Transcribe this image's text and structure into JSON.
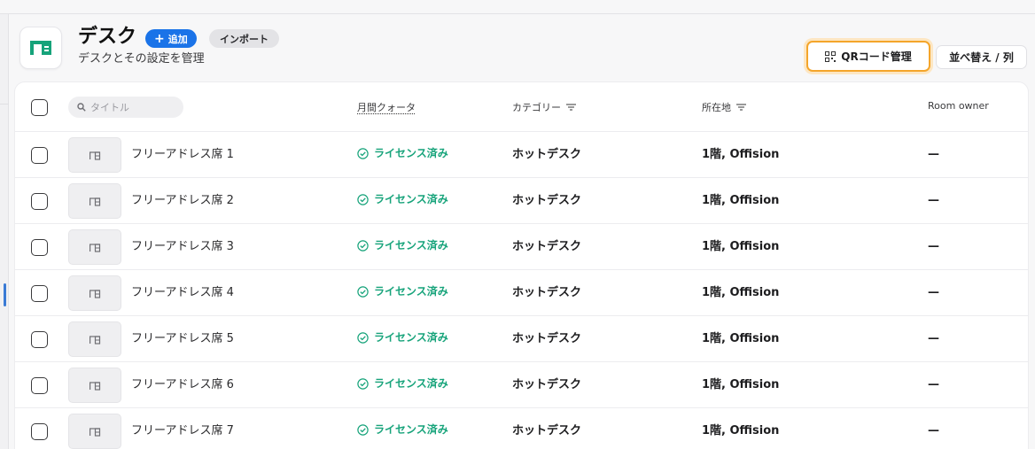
{
  "header": {
    "title": "デスク",
    "subtitle": "デスクとその設定を管理",
    "add_label": "追加",
    "import_label": "インポート",
    "qr_label": "QRコード管理",
    "sort_label": "並べ替え / 列",
    "icon": "desk-icon"
  },
  "table": {
    "search_placeholder": "タイトル",
    "columns": {
      "quota": "月間クォータ",
      "category": "カテゴリー",
      "location": "所在地",
      "owner": "Room owner"
    },
    "rows": [
      {
        "name": "フリーアドレス席 1",
        "quota": "ライセンス済み",
        "category": "ホットデスク",
        "location": "1階, Offision",
        "owner": "—"
      },
      {
        "name": "フリーアドレス席 2",
        "quota": "ライセンス済み",
        "category": "ホットデスク",
        "location": "1階, Offision",
        "owner": "—"
      },
      {
        "name": "フリーアドレス席 3",
        "quota": "ライセンス済み",
        "category": "ホットデスク",
        "location": "1階, Offision",
        "owner": "—"
      },
      {
        "name": "フリーアドレス席 4",
        "quota": "ライセンス済み",
        "category": "ホットデスク",
        "location": "1階, Offision",
        "owner": "—"
      },
      {
        "name": "フリーアドレス席 5",
        "quota": "ライセンス済み",
        "category": "ホットデスク",
        "location": "1階, Offision",
        "owner": "—"
      },
      {
        "name": "フリーアドレス席 6",
        "quota": "ライセンス済み",
        "category": "ホットデスク",
        "location": "1階, Offision",
        "owner": "—"
      },
      {
        "name": "フリーアドレス席 7",
        "quota": "ライセンス済み",
        "category": "ホットデスク",
        "location": "1階, Offision",
        "owner": "—"
      }
    ]
  },
  "colors": {
    "accent": "#1a73e8",
    "licensed": "#16a37a",
    "focus_ring": "#f4a52a"
  }
}
